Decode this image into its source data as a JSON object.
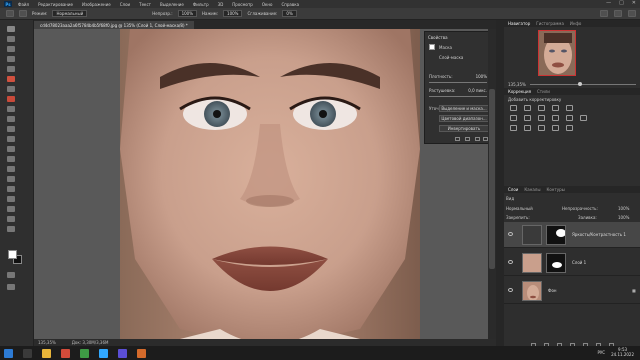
{
  "menubar": {
    "logo": "Ps",
    "items": [
      "Файл",
      "Редактирование",
      "Изображение",
      "Слои",
      "Текст",
      "Выделение",
      "Фильтр",
      "3D",
      "Просмотр",
      "Окно",
      "Справка"
    ],
    "win_controls": [
      "—",
      "□",
      "✕"
    ]
  },
  "options": {
    "mode_label": "Режим:",
    "mode_value": "Нормальный",
    "opacity_label": "Непрозр.:",
    "opacity_value": "100%",
    "flow_label": "Нажим:",
    "flow_value": "100%",
    "smooth_label": "Сглаживание:",
    "smooth_value": "0%"
  },
  "document": {
    "tab_title": "cd4d78023aaa2a6f5784b4b5f68f0.jpg @ 135% (Слой 1, Слой-маска/8) *"
  },
  "properties": {
    "title": "Свойства",
    "subtitle": "Маска",
    "layer_mask_label": "Слой-маска",
    "density_label": "Плотность:",
    "density_value": "100%",
    "feather_label": "Растушевка:",
    "feather_value": "0,0 пикс.",
    "refine_label": "Уточнить:",
    "select_mask_btn": "Выделение и маска...",
    "color_range_btn": "Цветовой диапазон...",
    "invert_btn": "Инвертировать"
  },
  "status": {
    "zoom": "135,35%",
    "doc": "Док: 3,30М/3,36М"
  },
  "right": {
    "top_tabs": [
      "Навигатор",
      "Гистограмма",
      "Инфо"
    ],
    "nav_zoom": "135,35%",
    "adj_tabs": [
      "Коррекция",
      "Стили"
    ],
    "adj_title": "Добавить корректировку",
    "layer_tabs": [
      "Слои",
      "Каналы",
      "Контуры"
    ],
    "kind_label": "Вид",
    "blend_mode": "Нормальный",
    "opacity_label": "Непрозрачность:",
    "opacity_value": "100%",
    "lock_label": "Закрепить:",
    "fill_label": "Заливка:",
    "fill_value": "100%",
    "layers": [
      {
        "name": "Яркость/Контрастность 1",
        "selected": true
      },
      {
        "name": "Слой 1",
        "selected": false
      },
      {
        "name": "Фон",
        "selected": false
      }
    ]
  },
  "taskbar": {
    "lang": "РУС",
    "time": "9:53",
    "date": "24.11.2022"
  },
  "colors": {
    "ps_blue": "#31a8ff",
    "skin": "#c99f8c",
    "lip": "#8f4f42"
  }
}
